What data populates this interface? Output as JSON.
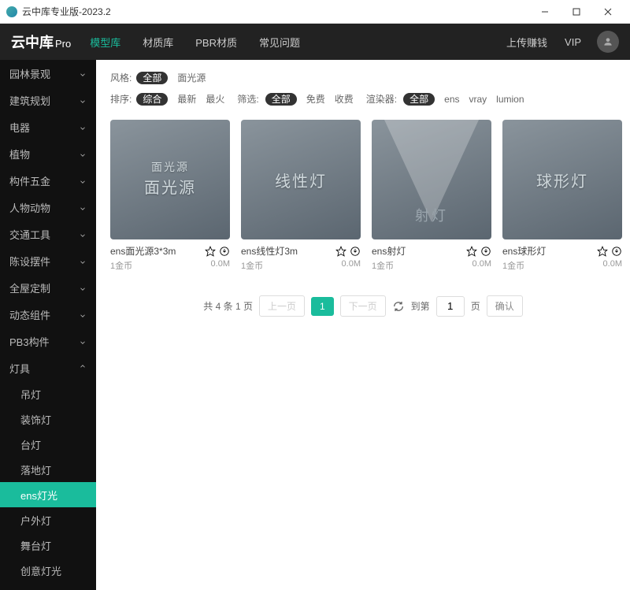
{
  "window": {
    "title": "云中库专业版-2023.2"
  },
  "brand": {
    "name": "云中库",
    "suffix": "Pro"
  },
  "nav": {
    "items": [
      {
        "label": "模型库",
        "active": true
      },
      {
        "label": "材质库",
        "active": false
      },
      {
        "label": "PBR材质",
        "active": false
      },
      {
        "label": "常见问题",
        "active": false
      }
    ],
    "right": [
      {
        "label": "上传赚钱"
      },
      {
        "label": "VIP"
      }
    ]
  },
  "sidebar": {
    "categories": [
      {
        "label": "园林景观",
        "expanded": false
      },
      {
        "label": "建筑规划",
        "expanded": false
      },
      {
        "label": "电器",
        "expanded": false
      },
      {
        "label": "植物",
        "expanded": false
      },
      {
        "label": "构件五金",
        "expanded": false
      },
      {
        "label": "人物动物",
        "expanded": false
      },
      {
        "label": "交通工具",
        "expanded": false
      },
      {
        "label": "陈设摆件",
        "expanded": false
      },
      {
        "label": "全屋定制",
        "expanded": false
      },
      {
        "label": "动态组件",
        "expanded": false
      },
      {
        "label": "PB3构件",
        "expanded": false
      },
      {
        "label": "灯具",
        "expanded": true,
        "children": [
          {
            "label": "吊灯",
            "active": false
          },
          {
            "label": "装饰灯",
            "active": false
          },
          {
            "label": "台灯",
            "active": false
          },
          {
            "label": "落地灯",
            "active": false
          },
          {
            "label": "ens灯光",
            "active": true
          },
          {
            "label": "户外灯",
            "active": false
          },
          {
            "label": "舞台灯",
            "active": false
          },
          {
            "label": "创意灯光",
            "active": false
          }
        ]
      }
    ]
  },
  "filters": {
    "style_label": "风格:",
    "style_opts": [
      {
        "label": "全部",
        "active": true
      },
      {
        "label": "面光源",
        "active": false
      }
    ],
    "sort_label": "排序:",
    "sort_opts": [
      {
        "label": "综合",
        "active": true
      },
      {
        "label": "最新",
        "active": false
      },
      {
        "label": "最火",
        "active": false
      }
    ],
    "select_label": "筛选:",
    "select_opts": [
      {
        "label": "全部",
        "active": true
      },
      {
        "label": "免费",
        "active": false
      },
      {
        "label": "收费",
        "active": false
      }
    ],
    "renderer_label": "渲染器:",
    "renderer_opts": [
      {
        "label": "全部",
        "active": true
      },
      {
        "label": "ens",
        "active": false
      },
      {
        "label": "vray",
        "active": false
      },
      {
        "label": "lumion",
        "active": false
      }
    ]
  },
  "cards": [
    {
      "title": "ens面光源3*3m",
      "thumb_label1": "面光源",
      "thumb_label2": "面光源",
      "price": "1金币",
      "size": "0.0M",
      "kind": "plane"
    },
    {
      "title": "ens线性灯3m",
      "thumb_label1": "线性灯",
      "thumb_label2": "",
      "price": "1金币",
      "size": "0.0M",
      "kind": "line"
    },
    {
      "title": "ens射灯",
      "thumb_label1": "射灯",
      "thumb_label2": "",
      "price": "1金币",
      "size": "0.0M",
      "kind": "spot"
    },
    {
      "title": "ens球形灯",
      "thumb_label1": "球形灯",
      "thumb_label2": "",
      "price": "1金币",
      "size": "0.0M",
      "kind": "sphere"
    }
  ],
  "pager": {
    "summary": "共 4 条 1 页",
    "prev": "上一页",
    "current": "1",
    "next": "下一页",
    "goto_label": "到第",
    "goto_value": "1",
    "page_unit": "页",
    "confirm": "确认"
  }
}
